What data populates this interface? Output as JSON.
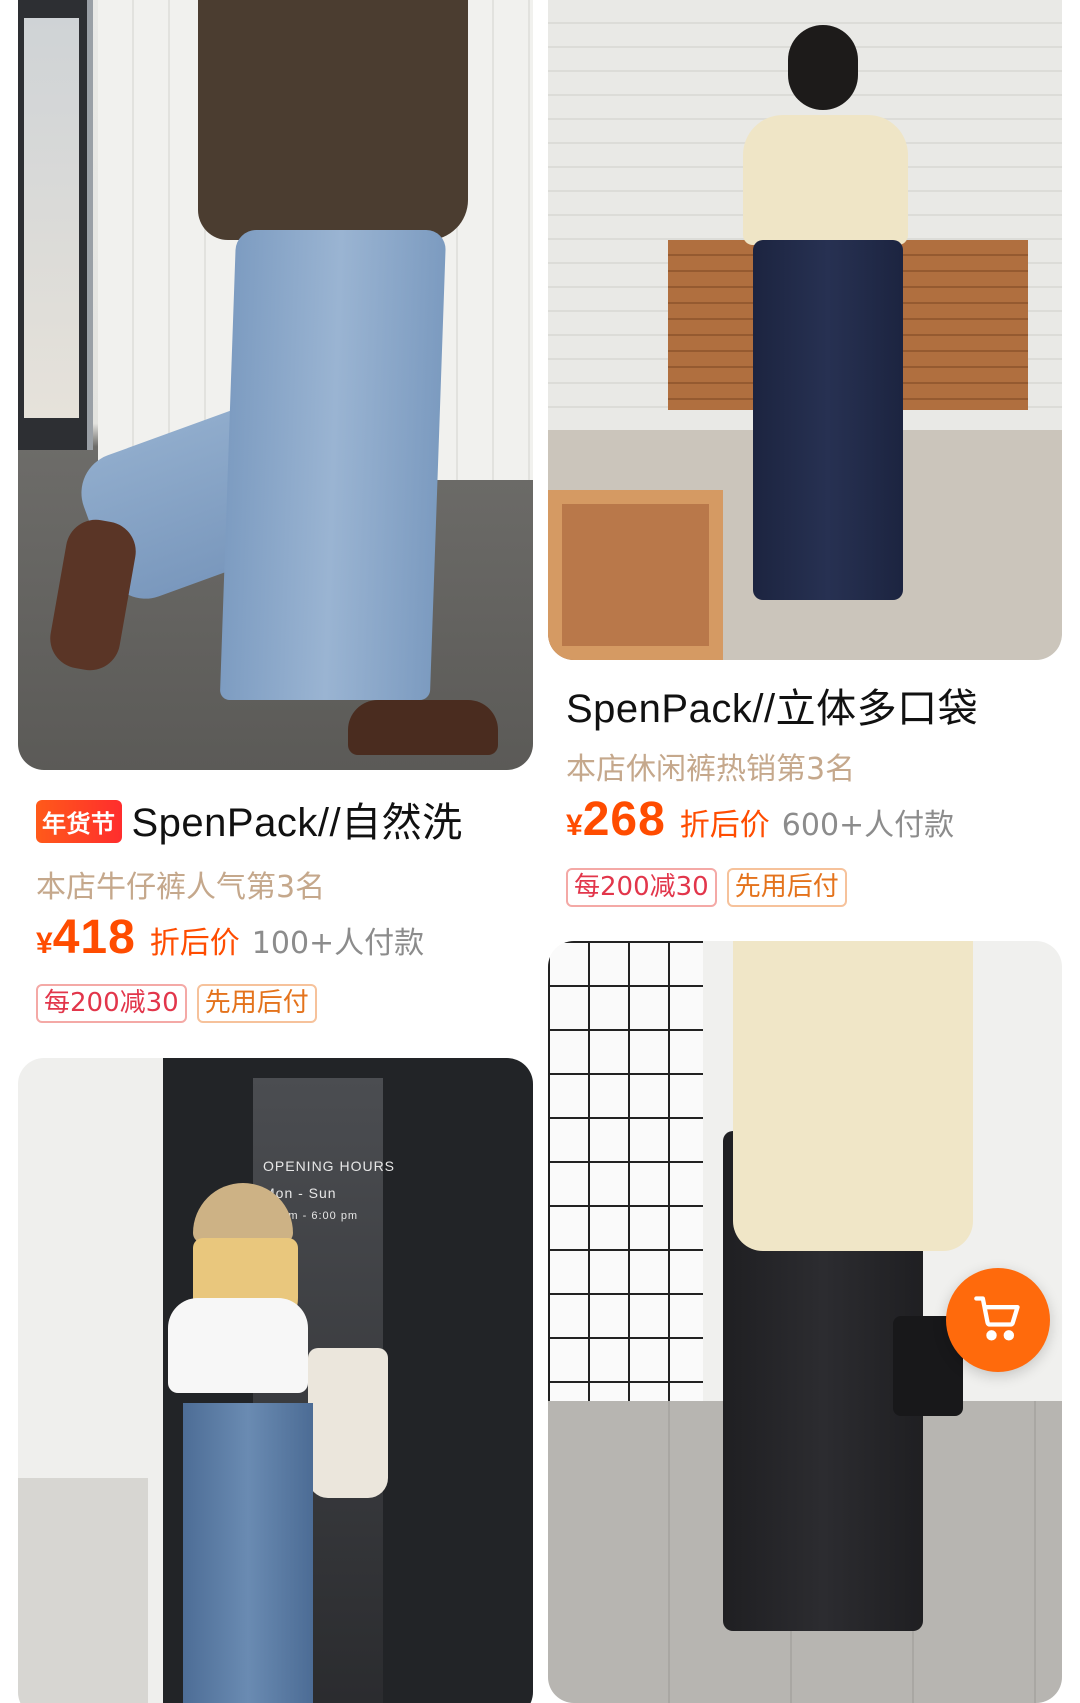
{
  "products": [
    {
      "badge": "年货节",
      "title": "SpenPack//自然洗",
      "rank": "本店牛仔裤人气第3名",
      "currency": "¥",
      "price": "418",
      "discount_label": "折后价",
      "paid": "100+人付款",
      "tags": [
        "每200减30",
        "先用后付"
      ]
    },
    {
      "badge": "",
      "title": "SpenPack//立体多口袋",
      "rank": "本店休闲裤热销第3名",
      "currency": "¥",
      "price": "268",
      "discount_label": "折后价",
      "paid": "600+人付款",
      "tags": [
        "每200减30",
        "先用后付"
      ]
    }
  ],
  "photo_text": {
    "hours_title": "OPENING HOURS",
    "hours_days": "Mon - Sun",
    "hours_time": "00 am - 6:00 pm"
  },
  "cart_button": {
    "icon": "shopping-cart-icon",
    "color": "#ff6a0c"
  },
  "colors": {
    "price": "#ff4c00",
    "tag_red": "#e2364b",
    "tag_orange": "#e4731c",
    "rank": "#c5a88c"
  }
}
